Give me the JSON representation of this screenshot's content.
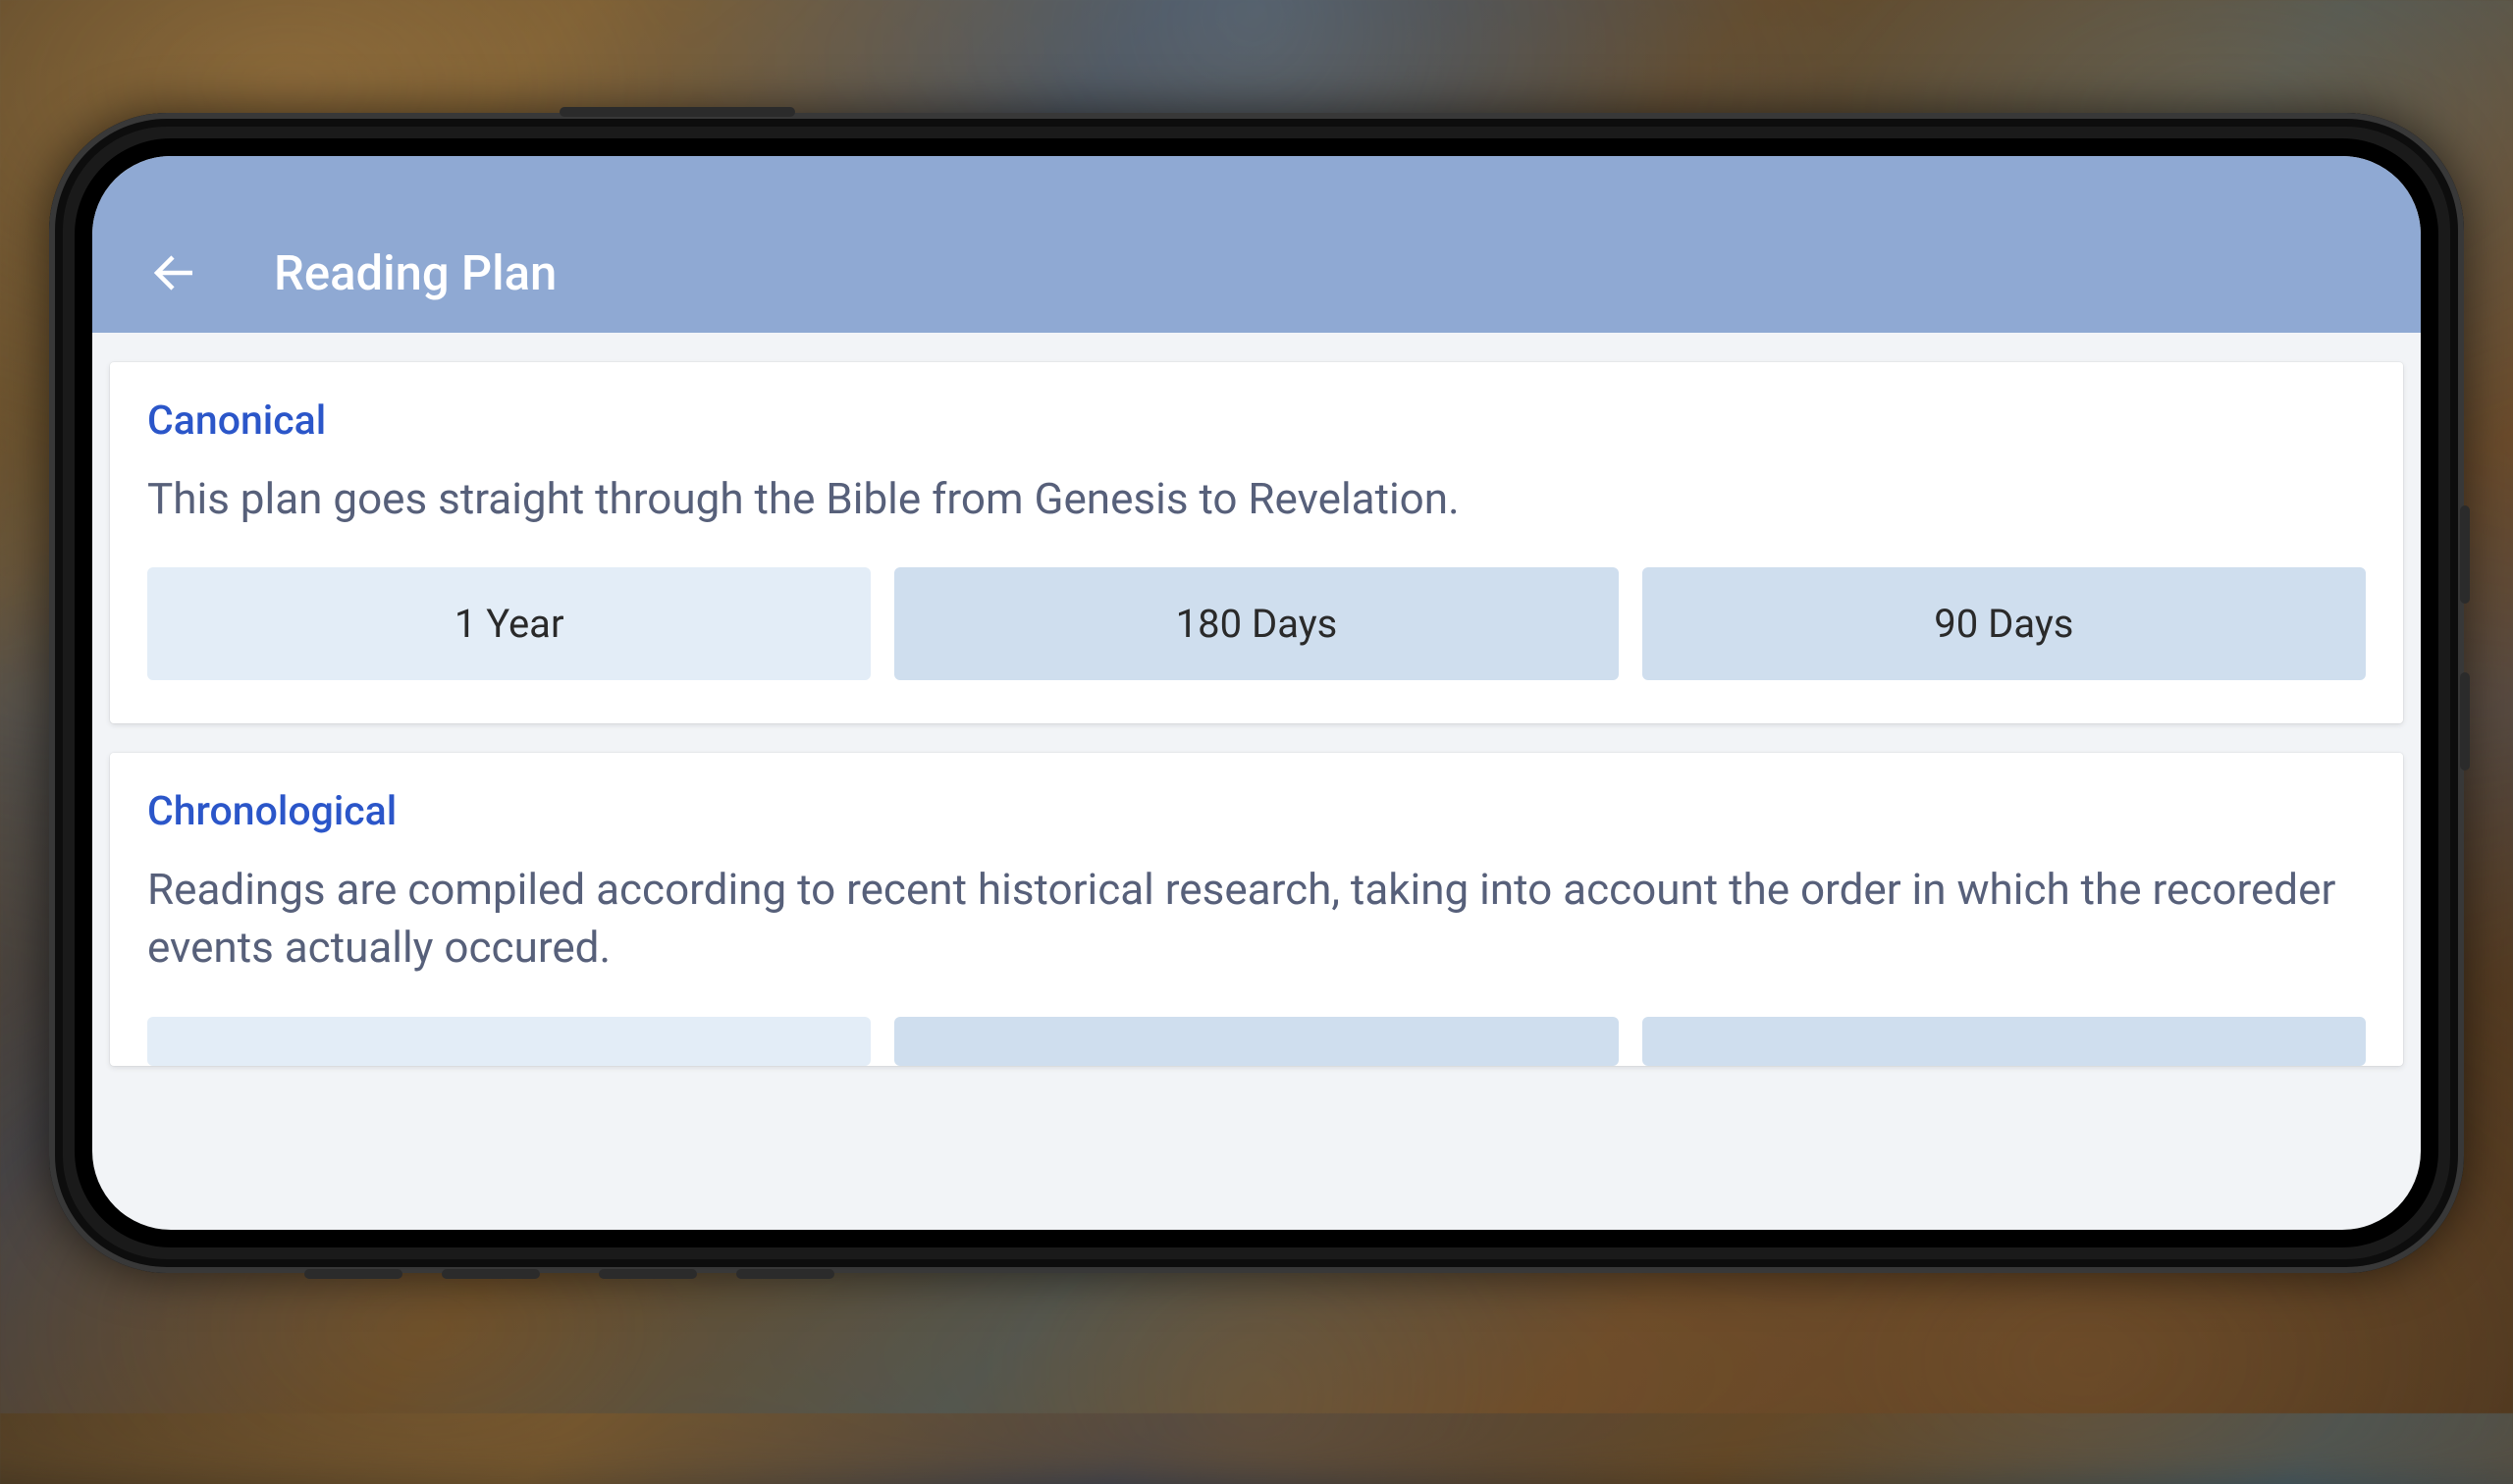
{
  "header": {
    "title": "Reading Plan"
  },
  "plans": [
    {
      "title": "Canonical",
      "description": "This plan goes straight through the Bible from Genesis to Revelation.",
      "durations": [
        "1 Year",
        "180 Days",
        "90 Days"
      ],
      "selectedIndex": 0
    },
    {
      "title": "Chronological",
      "description": "Readings are compiled according to recent historical research, taking into account the order in which the recoreder events actually occured.",
      "durations": [
        "",
        "",
        ""
      ],
      "selectedIndex": 0
    }
  ]
}
